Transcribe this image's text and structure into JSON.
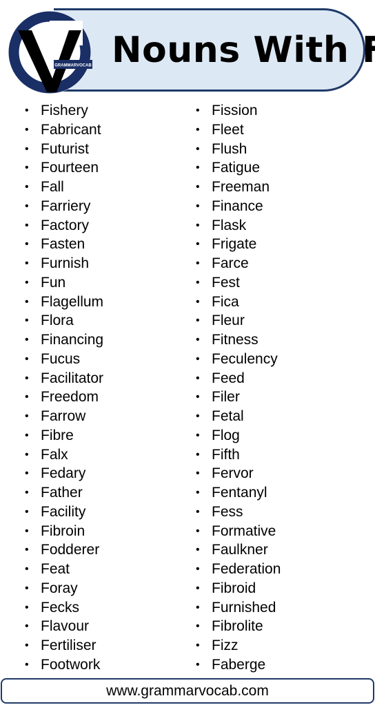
{
  "header": {
    "title": "Nouns With F",
    "logo_text": "GRAMMARVOCAB",
    "accent_color": "#1f3a68",
    "pill_color": "#dde8f5"
  },
  "columns": {
    "left": [
      "Fishery",
      "Fabricant",
      "Futurist",
      "Fourteen",
      "Fall",
      "Farriery",
      "Factory",
      "Fasten",
      "Furnish",
      "Fun",
      "Flagellum",
      "Flora",
      "Financing",
      "Fucus",
      "Facilitator",
      "Freedom",
      "Farrow",
      "Fibre",
      "Falx",
      "Fedary",
      "Father",
      "Facility",
      "Fibroin",
      "Fodderer",
      "Feat",
      "Foray",
      "Fecks",
      "Flavour",
      "Fertiliser",
      "Footwork"
    ],
    "right": [
      "Fission",
      "Fleet",
      "Flush",
      "Fatigue",
      "Freeman",
      "Finance",
      "Flask",
      "Frigate",
      "Farce",
      "Fest",
      "Fica",
      "Fleur",
      "Fitness",
      "Feculency",
      "Feed",
      "Filer",
      "Fetal",
      "Flog",
      "Fifth",
      "Fervor",
      "Fentanyl",
      "Fess",
      "Formative",
      "Faulkner",
      "Federation",
      "Fibroid",
      "Furnished",
      "Fibrolite",
      "Fizz",
      "Faberge"
    ]
  },
  "footer": {
    "website": "www.grammarvocab.com"
  }
}
